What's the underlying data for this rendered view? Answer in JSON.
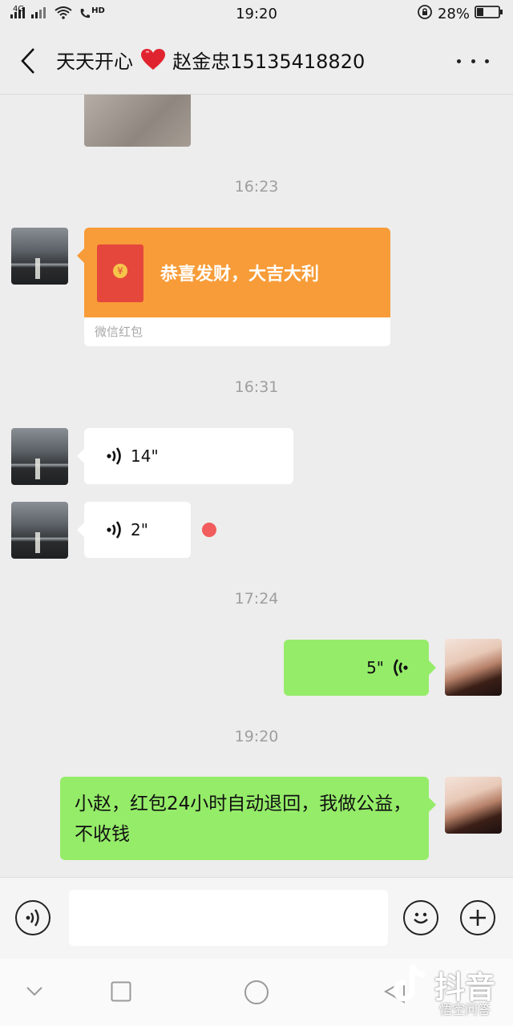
{
  "status_bar": {
    "signal_left": "4G",
    "hd_label": "HD",
    "time": "19:20",
    "battery": "28%"
  },
  "header": {
    "title_prefix": "天天开心",
    "title_suffix": "赵金忠15135418820"
  },
  "messages": {
    "time_1623": "16:23",
    "red_packet_text": "恭喜发财，大吉大利",
    "red_packet_label": "微信红包",
    "time_1631": "16:31",
    "voice_1": "14\"",
    "voice_2": "2\"",
    "time_1724": "17:24",
    "voice_3": "5\"",
    "time_1920": "19:20",
    "text_reply": "小赵，红包24小时自动退回，我做公益，不收钱"
  },
  "input": {
    "placeholder": ""
  },
  "watermark": {
    "brand": "抖音",
    "sub": "悟空问答"
  }
}
